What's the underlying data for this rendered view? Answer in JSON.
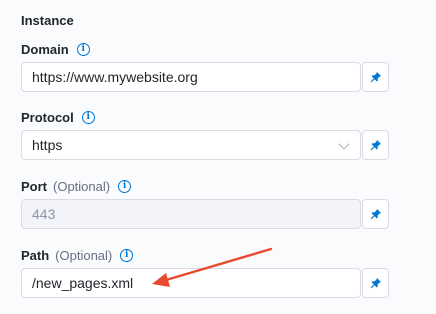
{
  "section": {
    "title": "Instance"
  },
  "fields": [
    {
      "label": "Domain",
      "optional": "",
      "value": "https://www.mywebsite.org",
      "placeholder": ""
    },
    {
      "label": "Protocol",
      "optional": "",
      "value": "https",
      "placeholder": ""
    },
    {
      "label": "Port",
      "optional": "(Optional)",
      "value": "",
      "placeholder": "443"
    },
    {
      "label": "Path",
      "optional": "(Optional)",
      "value": "/new_pages.xml",
      "placeholder": ""
    }
  ],
  "icons": {
    "info": "info-icon",
    "pin": "pin-icon",
    "dropdown": "chevron-down-icon"
  },
  "colors": {
    "accent": "#0278d5",
    "annotation_arrow": "#e8492f"
  }
}
